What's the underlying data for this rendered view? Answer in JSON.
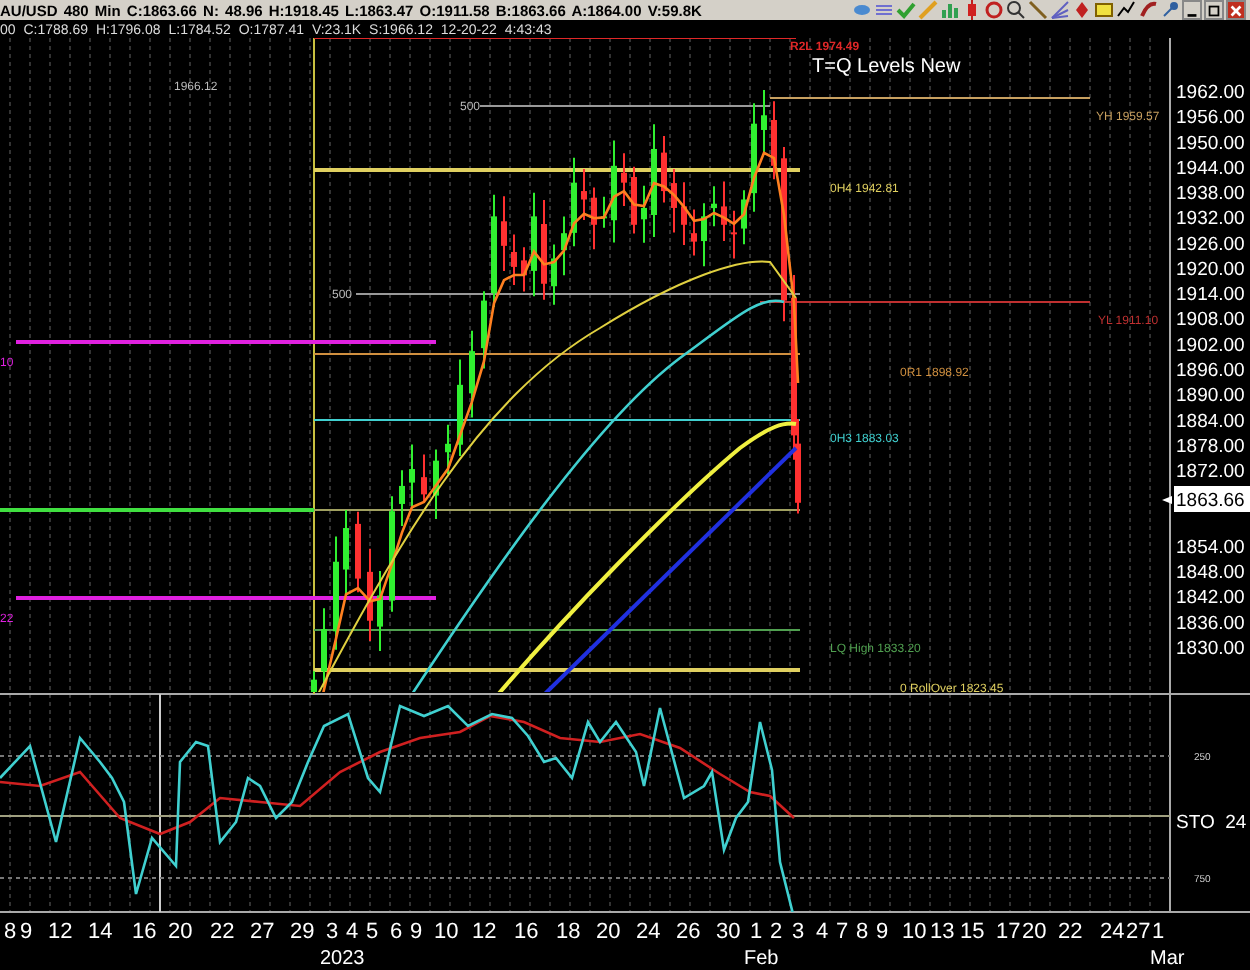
{
  "quote_bar": {
    "symbol": "AU/USD",
    "interval": "480 Min",
    "fields": [
      "C:1863.66",
      "N:  48.96",
      "H:1918.45",
      "L:1863.47",
      "O:1911.58",
      "B:1863.66",
      "A:1864.00",
      "V:59.8K"
    ]
  },
  "cursor_bar": {
    "fields": [
      "00",
      "C:1788.69",
      "H:1796.08",
      "L:1784.52",
      "O:1787.41",
      "V:23.1K",
      "S:1966.12",
      "12-20-22",
      "4:43:43"
    ]
  },
  "chart": {
    "title": "T=Q Levels New",
    "notes": [
      "1966.12",
      "500",
      "500"
    ],
    "level_labels": [
      {
        "text": "R2L 1974.49",
        "color": "#e02828"
      },
      {
        "text": "YH 1959.57",
        "color": "#c8a060"
      },
      {
        "text": "0H4 1942.81",
        "color": "#e0d060"
      },
      {
        "text": "YL 1911.10",
        "color": "#c03030"
      },
      {
        "text": "0R1 1898.92",
        "color": "#d09040"
      },
      {
        "text": "0H3 1883.03",
        "color": "#40d0d0"
      },
      {
        "text": "LQ High 1833.20",
        "color": "#50a050"
      },
      {
        "text": "0 RollOver 1823.45",
        "color": "#e0d060"
      },
      {
        "text": "10",
        "color": "#e020e0"
      },
      {
        "text": "22",
        "color": "#e020e0"
      }
    ]
  },
  "price_axis": {
    "ticks": [
      "1962.00",
      "1956.00",
      "1950.00",
      "1944.00",
      "1938.00",
      "1932.00",
      "1926.00",
      "1920.00",
      "1914.00",
      "1908.00",
      "1902.00",
      "1896.00",
      "1890.00",
      "1884.00",
      "1878.00",
      "1872.00",
      "1854.00",
      "1848.00",
      "1842.00",
      "1836.00",
      "1830.00"
    ],
    "last_price": "1863.66"
  },
  "oscillator": {
    "name": "STO  24",
    "ticks": [
      "250",
      "750"
    ]
  },
  "date_axis": {
    "days": [
      "8",
      "9",
      "12",
      "14",
      "16",
      "20",
      "22",
      "27",
      "29",
      "3",
      "4",
      "5",
      "6",
      "9",
      "10",
      "12",
      "16",
      "18",
      "20",
      "24",
      "26",
      "30",
      "1",
      "2",
      "3",
      "4",
      "7",
      "8",
      "9",
      "10",
      "13",
      "15",
      "17",
      "20",
      "22",
      "24",
      "27",
      "1"
    ],
    "months": [
      "2023",
      "Feb",
      "Mar"
    ]
  }
}
